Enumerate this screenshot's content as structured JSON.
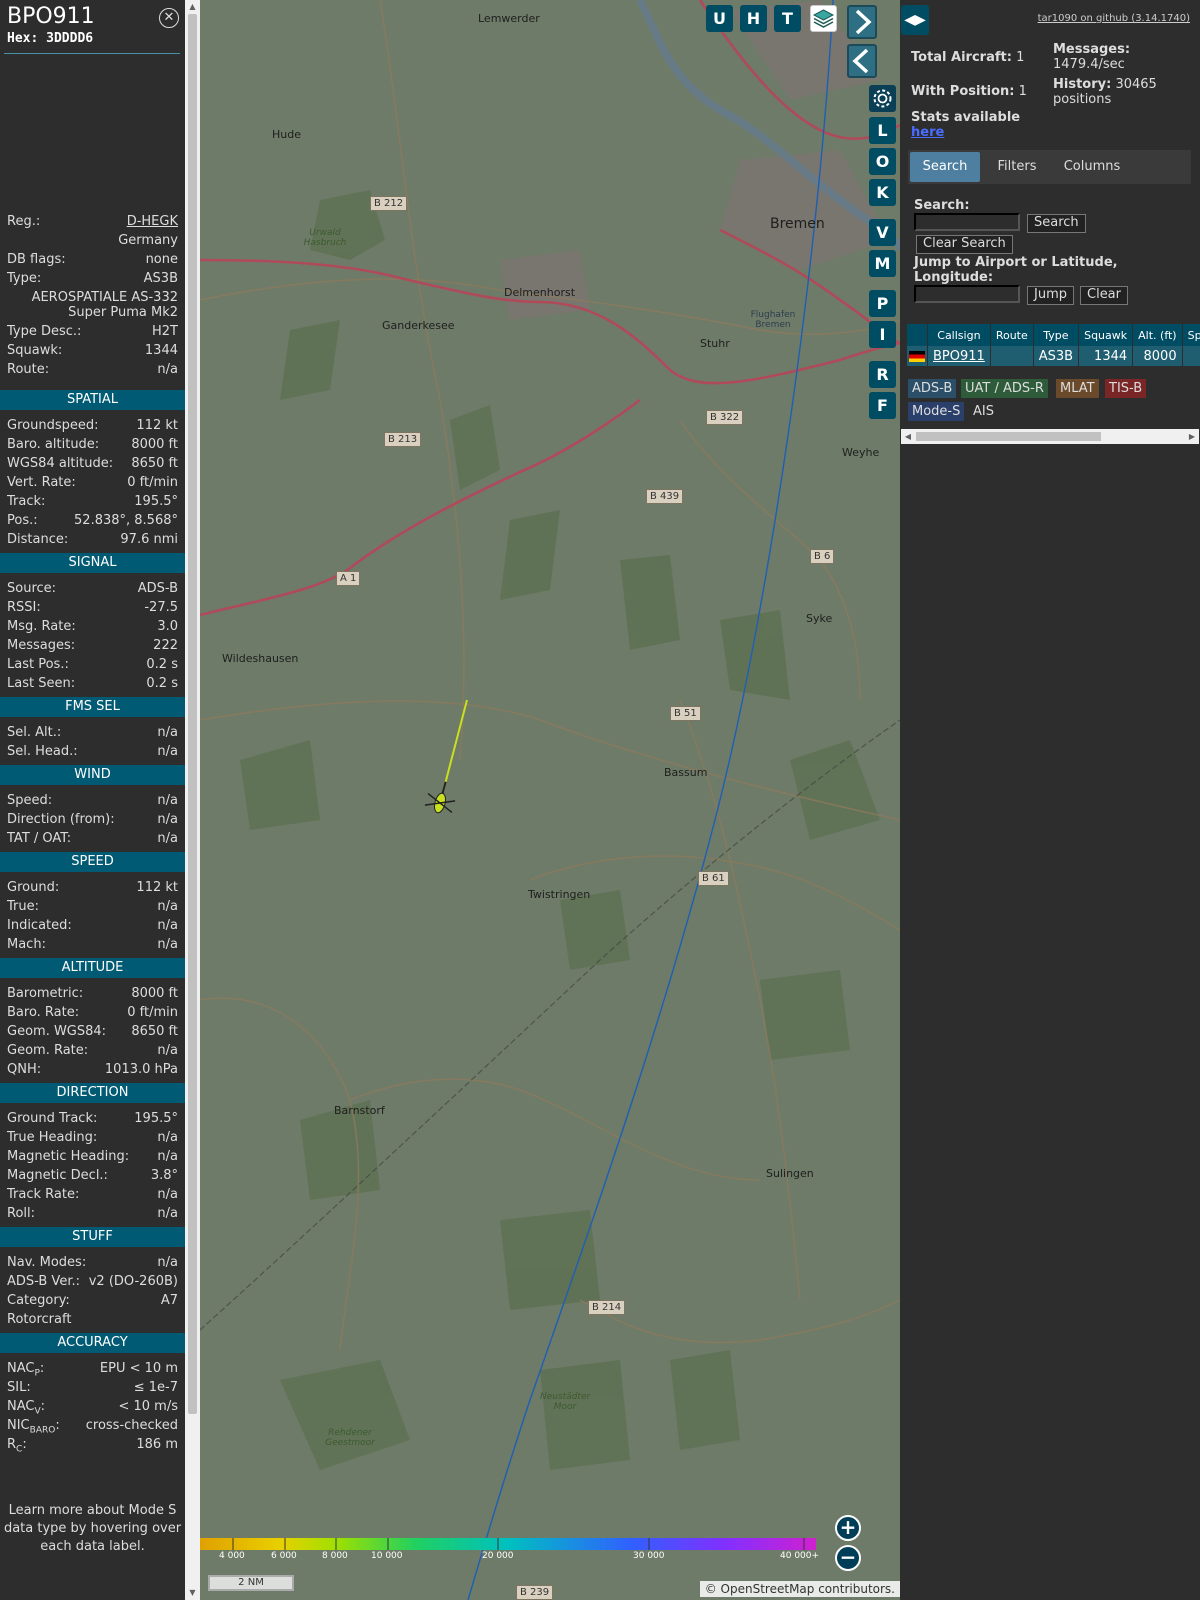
{
  "aircraft": {
    "callsign": "BPO911",
    "hex": "Hex:  3DDDD6",
    "top_rows": [
      {
        "key": "Reg.:",
        "value": "D-HEGK",
        "link": true
      },
      {
        "key": "",
        "value": "Germany"
      },
      {
        "key": "DB flags:",
        "value": "none"
      },
      {
        "key": "Type:",
        "value": "AS3B"
      },
      {
        "key": "",
        "value": "AEROSPATIALE AS-332 Super Puma Mk2",
        "two": true
      },
      {
        "key": "Type Desc.:",
        "value": "H2T"
      },
      {
        "key": "Squawk:",
        "value": "1344"
      },
      {
        "key": "Route:",
        "value": "n/a"
      }
    ],
    "sections": [
      {
        "title": "SPATIAL",
        "rows": [
          {
            "key": "Groundspeed:",
            "value": "112 kt"
          },
          {
            "key": "Baro. altitude:",
            "value": "8000 ft"
          },
          {
            "key": "WGS84 altitude:",
            "value": "8650 ft"
          },
          {
            "key": "Vert. Rate:",
            "value": "0 ft/min"
          },
          {
            "key": "Track:",
            "value": "195.5°"
          },
          {
            "key": "Pos.:",
            "value": "52.838°, 8.568°"
          },
          {
            "key": "Distance:",
            "value": "97.6 nmi"
          }
        ]
      },
      {
        "title": "SIGNAL",
        "rows": [
          {
            "key": "Source:",
            "value": "ADS-B"
          },
          {
            "key": "RSSI:",
            "value": "-27.5"
          },
          {
            "key": "Msg. Rate:",
            "value": "3.0"
          },
          {
            "key": "Messages:",
            "value": "222"
          },
          {
            "key": "Last Pos.:",
            "value": "0.2 s"
          },
          {
            "key": "Last Seen:",
            "value": "0.2 s"
          }
        ]
      },
      {
        "title": "FMS SEL",
        "rows": [
          {
            "key": "Sel. Alt.:",
            "value": "n/a"
          },
          {
            "key": "Sel. Head.:",
            "value": "n/a"
          }
        ]
      },
      {
        "title": "WIND",
        "rows": [
          {
            "key": "Speed:",
            "value": "n/a"
          },
          {
            "key": "Direction (from):",
            "value": "n/a"
          },
          {
            "key": "TAT / OAT:",
            "value": "n/a"
          }
        ]
      },
      {
        "title": "SPEED",
        "rows": [
          {
            "key": "Ground:",
            "value": "112 kt"
          },
          {
            "key": "True:",
            "value": "n/a"
          },
          {
            "key": "Indicated:",
            "value": "n/a"
          },
          {
            "key": "Mach:",
            "value": "n/a"
          }
        ]
      },
      {
        "title": "ALTITUDE",
        "rows": [
          {
            "key": "Barometric:",
            "value": "8000 ft"
          },
          {
            "key": "Baro. Rate:",
            "value": "0 ft/min"
          },
          {
            "key": "Geom. WGS84:",
            "value": "8650 ft"
          },
          {
            "key": "Geom. Rate:",
            "value": "n/a"
          },
          {
            "key": "QNH:",
            "value": "1013.0 hPa"
          }
        ]
      },
      {
        "title": "DIRECTION",
        "rows": [
          {
            "key": "Ground Track:",
            "value": "195.5°"
          },
          {
            "key": "True Heading:",
            "value": "n/a"
          },
          {
            "key": "Magnetic Heading:",
            "value": "n/a"
          },
          {
            "key": "Magnetic Decl.:",
            "value": "3.8°"
          },
          {
            "key": "Track Rate:",
            "value": "n/a"
          },
          {
            "key": "Roll:",
            "value": "n/a"
          }
        ]
      },
      {
        "title": "STUFF",
        "rows": [
          {
            "key": "Nav. Modes:",
            "value": "n/a"
          },
          {
            "key": "ADS-B Ver.:",
            "value": "v2 (DO-260B)"
          },
          {
            "key": "Category:",
            "value": "A7"
          },
          {
            "key": "Rotorcraft",
            "value": ""
          }
        ]
      },
      {
        "title": "ACCURACY",
        "rows": [
          {
            "key": "NAC",
            "sub": "P",
            "value": "EPU < 10 m"
          },
          {
            "key": "SIL:",
            "value": "≤ 1e-7"
          },
          {
            "key": "NAC",
            "sub": "V",
            "value": "< 10 m/s"
          },
          {
            "key": "NIC",
            "sub": "BARO",
            "value": "cross-checked"
          },
          {
            "key": "R",
            "sub": "C",
            "value": "186 m"
          }
        ]
      }
    ],
    "hint": "Learn more about Mode S data type by hovering over each data label."
  },
  "map": {
    "top_buttons": [
      "U",
      "H",
      "T"
    ],
    "side_buttons": [
      "L",
      "O",
      "K",
      "V",
      "M",
      "P",
      "I",
      "R",
      "F"
    ],
    "places": [
      {
        "name": "Lemwerder"
      },
      {
        "name": "Hude"
      },
      {
        "name": "Bremen"
      },
      {
        "name": "Delmenhorst"
      },
      {
        "name": "Ganderkesee"
      },
      {
        "name": "Stuhr"
      },
      {
        "name": "Weyhe"
      },
      {
        "name": "Wildeshausen"
      },
      {
        "name": "Syke"
      },
      {
        "name": "Bassum"
      },
      {
        "name": "Twistringen"
      },
      {
        "name": "Barnstorf"
      },
      {
        "name": "Sulingen"
      },
      {
        "name": "Flughafen Bremen"
      }
    ],
    "roads": [
      "B 212",
      "B 213",
      "B 322",
      "B 439",
      "A 1",
      "B 6",
      "B 51",
      "B 61",
      "B 214",
      "B 239"
    ],
    "woods": [
      "Urwald Hasbruch",
      "Rehdener Geestmoor",
      "Neustädter Moor"
    ],
    "legend_ticks": [
      "4 000",
      "6 000",
      "8 000",
      "10 000",
      "20 000",
      "30 000",
      "40 000+"
    ],
    "scale": "2 NM",
    "attribution": "© OpenStreetMap contributors."
  },
  "right": {
    "github": "tar1090 on github (3.14.1740)",
    "total_label": "Total Aircraft:",
    "total_value": "1",
    "withpos_label": "With Position:",
    "withpos_value": "1",
    "messages_label": "Messages:",
    "messages_value": "1479.4/sec",
    "history_label": "History:",
    "history_value": "30465 positions",
    "stats_label": "Stats available",
    "stats_link": "here",
    "tabs": [
      "Search",
      "Filters",
      "Columns"
    ],
    "search_label": "Search:",
    "search_btn": "Search",
    "clear_search_btn": "Clear Search",
    "jump_label": "Jump to Airport or Latitude, Longitude:",
    "jump_btn": "Jump",
    "clear_btn": "Clear",
    "table_headers": [
      "Callsign",
      "Route",
      "Type",
      "Squawk",
      "Alt. (ft)",
      "Spd."
    ],
    "table_row": {
      "callsign": "BPO911",
      "route": "",
      "type": "AS3B",
      "squawk": "1344",
      "alt": "8000"
    },
    "sources": [
      {
        "label": "ADS-B",
        "color": "#2b4f68"
      },
      {
        "label": "UAT / ADS-R",
        "color": "#2e5c3a"
      },
      {
        "label": "MLAT",
        "color": "#6b4a2b"
      },
      {
        "label": "TIS-B",
        "color": "#7a2626"
      },
      {
        "label": "Mode-S",
        "color": "#2b3f6b"
      },
      {
        "label": "AIS",
        "color": "#2d2d2d"
      }
    ]
  }
}
